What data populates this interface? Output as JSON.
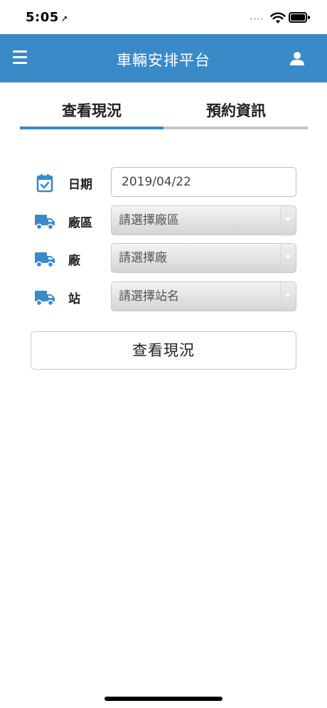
{
  "status_bar": {
    "time": "5:05",
    "location_icon": "location-arrow-icon",
    "wifi_icon": "wifi-icon",
    "battery_icon": "battery-icon"
  },
  "navbar": {
    "title": "車輛安排平台",
    "menu_icon": "hamburger-menu-icon",
    "user_icon": "user-icon",
    "background": "#3a8ac8"
  },
  "tabs": [
    {
      "label": "查看現況",
      "active": true
    },
    {
      "label": "預約資訊",
      "active": false
    }
  ],
  "form": {
    "date": {
      "label": "日期",
      "value": "2019/04/22",
      "icon": "calendar-check-icon"
    },
    "area": {
      "label": "廠區",
      "placeholder": "請選擇廠區",
      "icon": "truck-icon"
    },
    "plant": {
      "label": "廠",
      "placeholder": "請選擇廠",
      "icon": "truck-icon"
    },
    "station": {
      "label": "站",
      "placeholder": "請選擇站名",
      "icon": "truck-icon"
    }
  },
  "button": {
    "label": "查看現況"
  },
  "colors": {
    "accent": "#3a8ac8",
    "inactive_tab_line": "#c6c6c6"
  }
}
